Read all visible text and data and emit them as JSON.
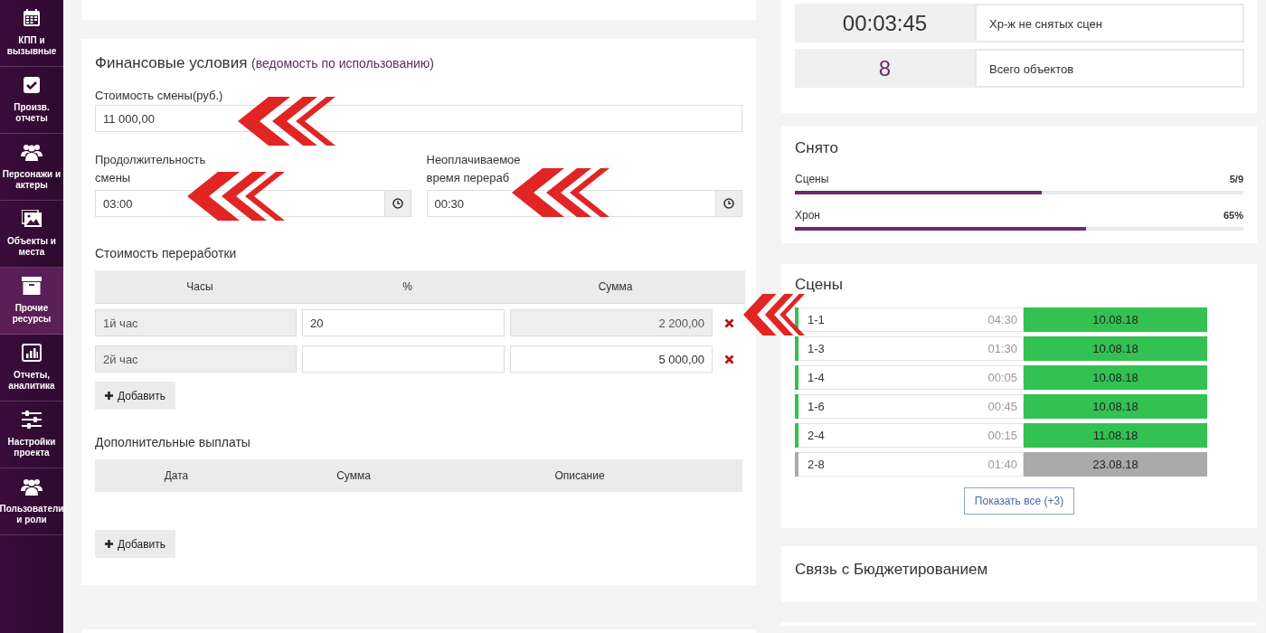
{
  "sidebar": {
    "items": [
      {
        "label": "КПП и вызывные",
        "selected": false
      },
      {
        "label": "Произв. отчеты",
        "selected": false
      },
      {
        "label": "Персонажи и актеры",
        "selected": false
      },
      {
        "label": "Объекты и места",
        "selected": false
      },
      {
        "label": "Прочие ресурсы",
        "selected": true
      },
      {
        "label": "Отчеты, аналитика",
        "selected": false
      },
      {
        "label": "Настройки проекта",
        "selected": false
      },
      {
        "label": "Пользователи и роли",
        "selected": false
      }
    ]
  },
  "finance": {
    "title": "Финансовые условия",
    "subtitle": "(ведомость по использованию)",
    "shift_cost": {
      "label": "Стоимость смены(руб.)",
      "value": "11 000,00"
    },
    "shift_duration": {
      "label": "Продолжительность смены",
      "value": "03:00"
    },
    "unpaid_overtime": {
      "label": "Неоплачиваемое время перераб",
      "value": "00:30"
    },
    "overtime": {
      "title": "Стоимость переработки",
      "columns": [
        "Часы",
        "%",
        "Сумма"
      ],
      "rows": [
        {
          "hour": "1й час",
          "percent": "20",
          "sum": "2 200,00",
          "sum_readonly": true
        },
        {
          "hour": "2й час",
          "sum": "5 000,00",
          "sum_readonly": false
        }
      ],
      "add_button": "Добавить"
    },
    "extra_payments": {
      "title": "Дополнительные выплаты",
      "columns": [
        "Дата",
        "Сумма",
        "Описание"
      ],
      "add_button": "Добавить"
    }
  },
  "stats": [
    {
      "value": "00:03:45",
      "label": "Хр-ж не снятых сцен",
      "kind": "time"
    },
    {
      "value": "8",
      "label": "Всего объектов",
      "kind": "count"
    }
  ],
  "shot": {
    "title": "Снято",
    "bars": [
      {
        "label": "Сцены",
        "reading": "5/9",
        "level": 0.55
      },
      {
        "label": "Хрон",
        "reading": "65%",
        "level": 0.65
      }
    ]
  },
  "scenes": {
    "title": "Сцены",
    "items": [
      {
        "name": "1-1",
        "duration": "04:30",
        "date": "10.08.18",
        "color": "#33c152"
      },
      {
        "name": "1-3",
        "duration": "01:30",
        "date": "10.08.18",
        "color": "#33c152"
      },
      {
        "name": "1-4",
        "duration": "00:05",
        "date": "10.08.18",
        "color": "#33c152"
      },
      {
        "name": "1-6",
        "duration": "00:45",
        "date": "10.08.18",
        "color": "#33c152"
      },
      {
        "name": "2-4",
        "duration": "00:15",
        "date": "11.08.18",
        "color": "#33c152"
      },
      {
        "name": "2-8",
        "duration": "01:40",
        "date": "23.08.18",
        "color": "#aaaaaa"
      }
    ],
    "show_all_button": "Показать все (+3)"
  },
  "budget": {
    "title": "Связь с Бюджетированием"
  }
}
